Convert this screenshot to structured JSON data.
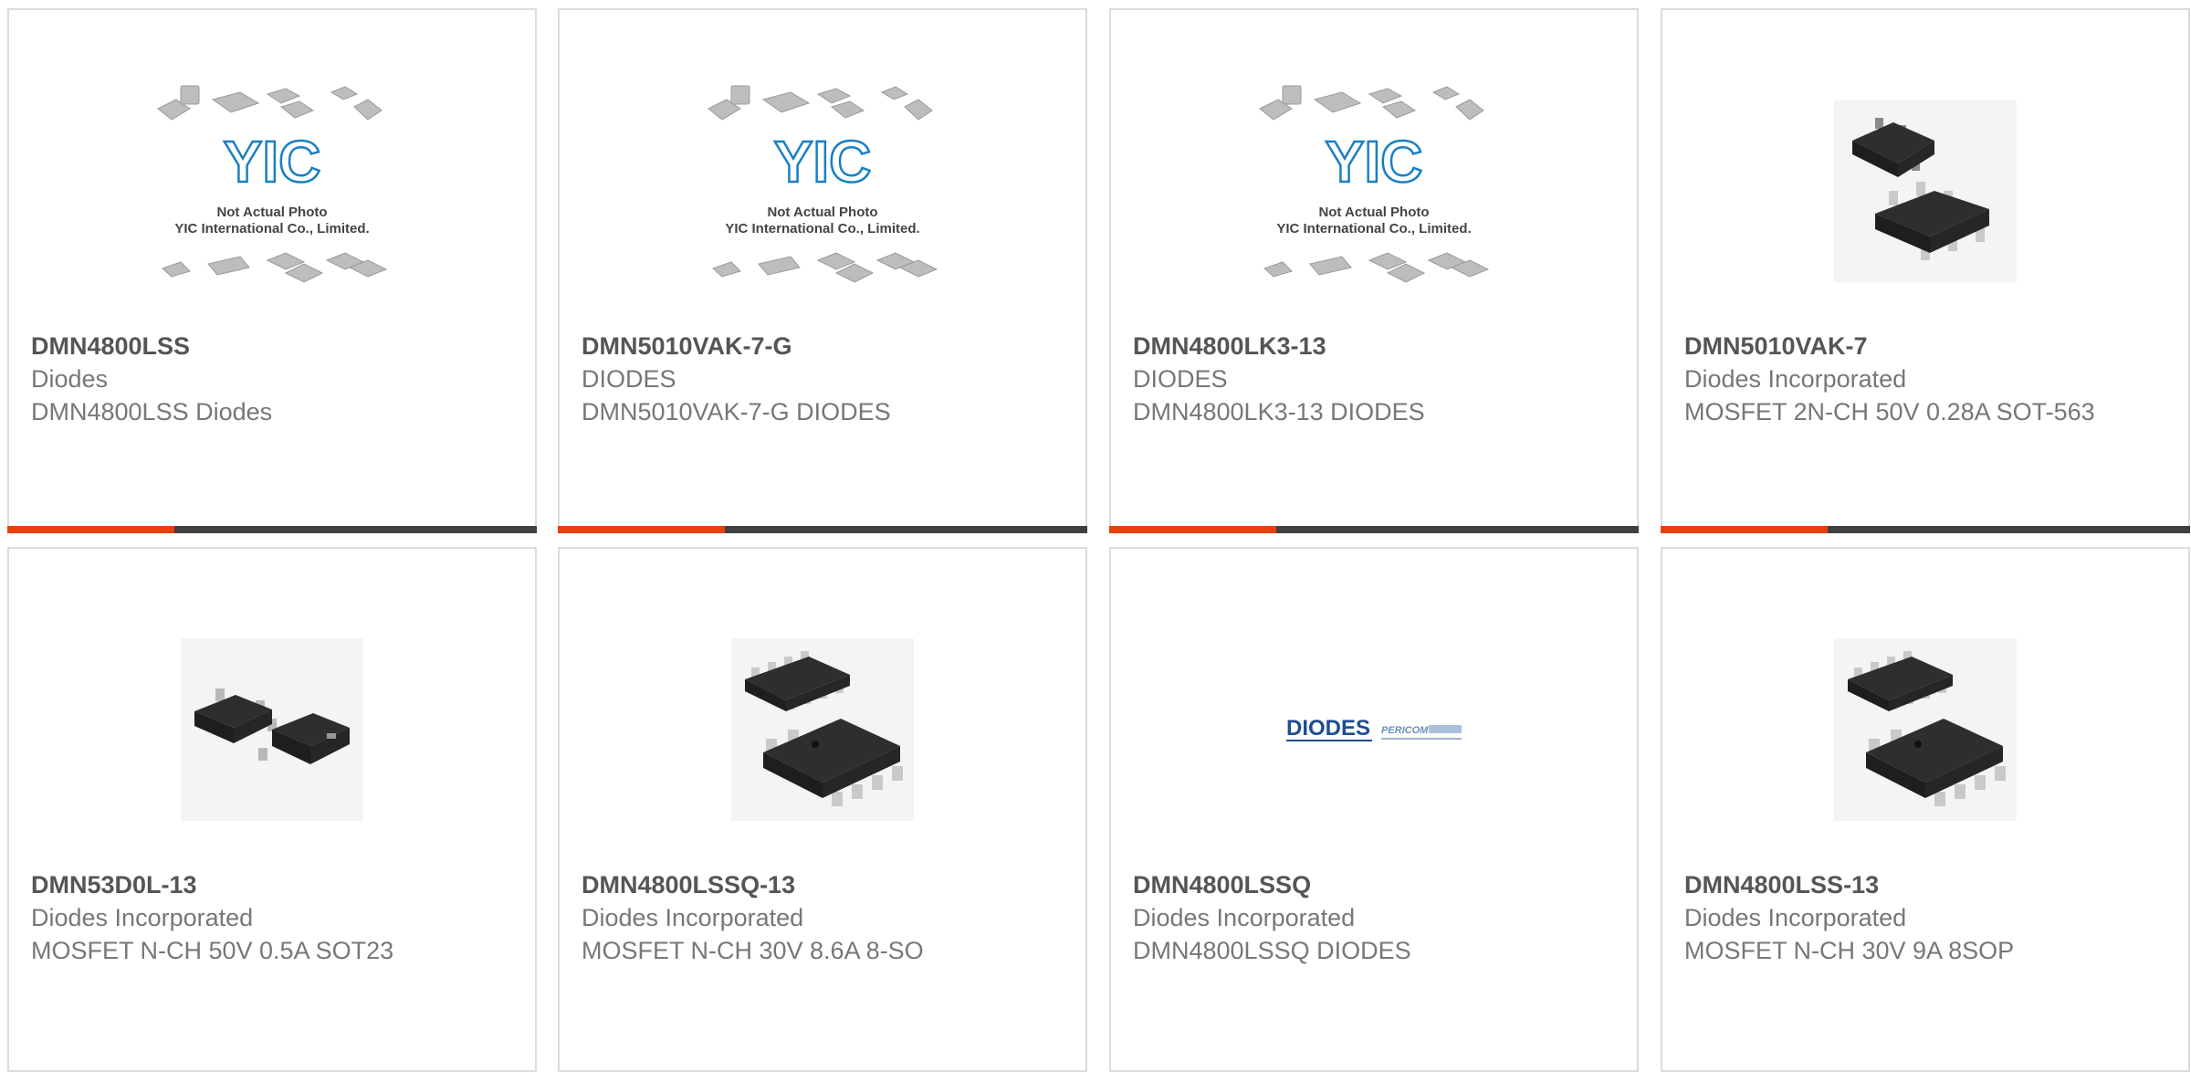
{
  "products": [
    {
      "part": "DMN4800LSS",
      "manufacturer": "Diodes",
      "description": "DMN4800LSS Diodes",
      "image": "placeholder-yic"
    },
    {
      "part": "DMN5010VAK-7-G",
      "manufacturer": "DIODES",
      "description": "DMN5010VAK-7-G DIODES",
      "image": "placeholder-yic"
    },
    {
      "part": "DMN4800LK3-13",
      "manufacturer": "DIODES",
      "description": "DMN4800LK3-13 DIODES",
      "image": "placeholder-yic"
    },
    {
      "part": "DMN5010VAK-7",
      "manufacturer": "Diodes Incorporated",
      "description": "MOSFET 2N-CH 50V 0.28A SOT-563",
      "image": "sot563-chip"
    },
    {
      "part": "DMN53D0L-13",
      "manufacturer": "Diodes Incorporated",
      "description": "MOSFET N-CH 50V 0.5A SOT23",
      "image": "sot23-chip"
    },
    {
      "part": "DMN4800LSSQ-13",
      "manufacturer": "Diodes Incorporated",
      "description": "MOSFET N-CH 30V 8.6A 8-SO",
      "image": "soic8-chip"
    },
    {
      "part": "DMN4800LSSQ",
      "manufacturer": "Diodes Incorporated",
      "description": "DMN4800LSSQ DIODES",
      "image": "diodes-pericom-logo"
    },
    {
      "part": "DMN4800LSS-13",
      "manufacturer": "Diodes Incorporated",
      "description": "MOSFET N-CH 30V 9A 8SOP",
      "image": "soic8-chip"
    }
  ],
  "placeholder": {
    "brand": "YIC",
    "line1": "Not Actual Photo",
    "line2": "YIC International Co., Limited."
  },
  "logo": {
    "diodes": "DIODES",
    "pericom": "PERICOM"
  },
  "colors": {
    "accent": "#e8400c",
    "bar": "#404040",
    "border": "#dcdcdc",
    "yic_blue": "#1a7fc1"
  }
}
